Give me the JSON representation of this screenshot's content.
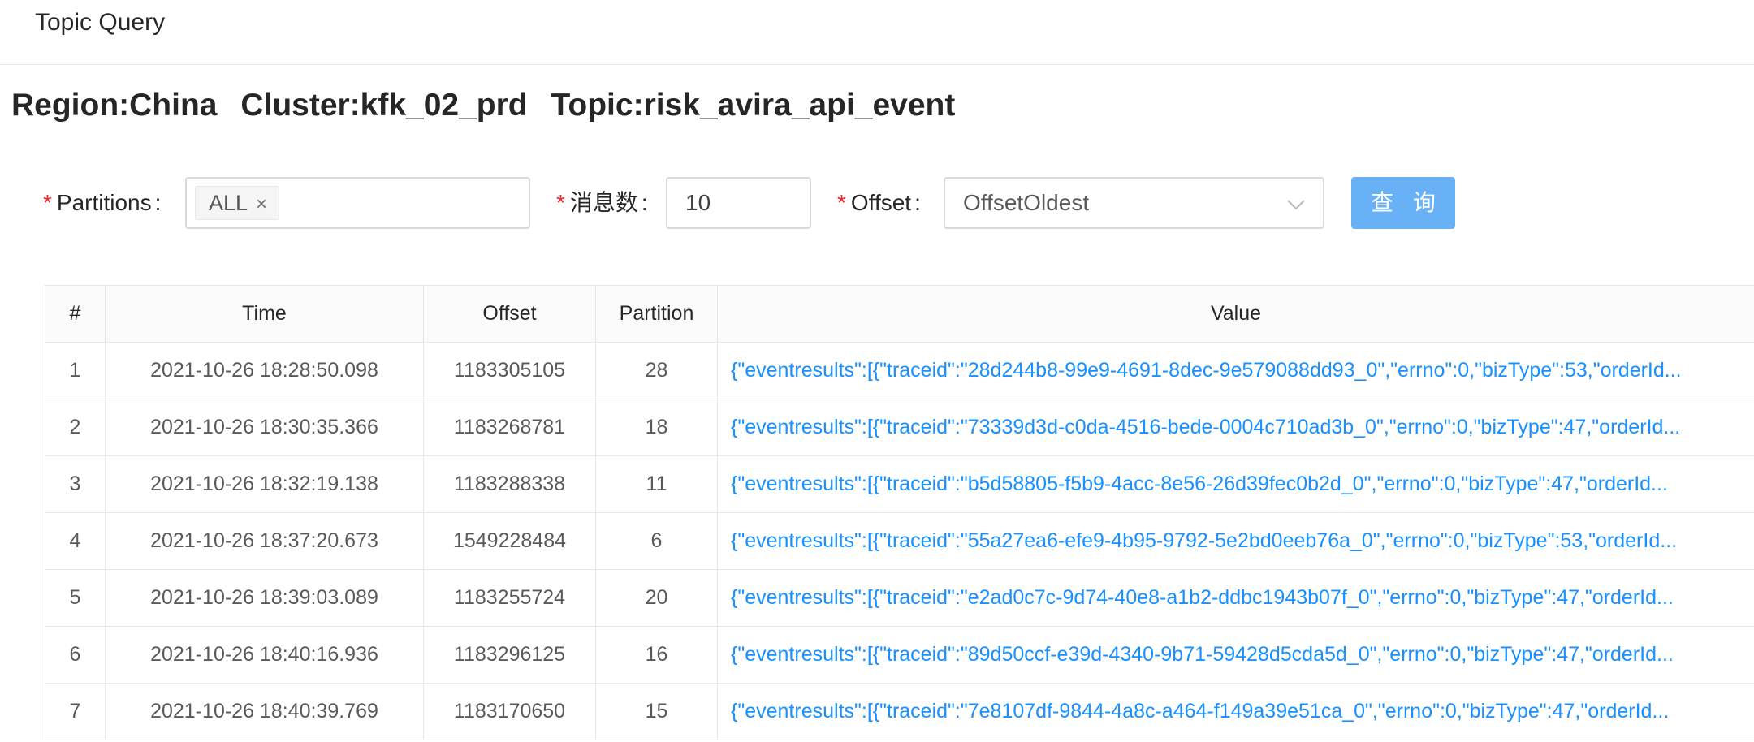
{
  "header": {
    "title": "Topic Query"
  },
  "heading": {
    "region": "Region:China",
    "cluster": "Cluster:kfk_02_prd",
    "topic": "Topic:risk_avira_api_event"
  },
  "form": {
    "partitions_label": "Partitions",
    "partitions_tag": "ALL",
    "count_label": "消息数",
    "count_value": "10",
    "offset_label": "Offset",
    "offset_value": "OffsetOldest",
    "query_button": "查 询",
    "colon": ":",
    "required_mark": "*"
  },
  "table": {
    "columns": [
      "#",
      "Time",
      "Offset",
      "Partition",
      "Value"
    ],
    "rows": [
      {
        "num": "1",
        "time": "2021-10-26 18:28:50.098",
        "offset": "1183305105",
        "partition": "28",
        "value": "{\"eventresults\":[{\"traceid\":\"28d244b8-99e9-4691-8dec-9e579088dd93_0\",\"errno\":0,\"bizType\":53,\"orderId..."
      },
      {
        "num": "2",
        "time": "2021-10-26 18:30:35.366",
        "offset": "1183268781",
        "partition": "18",
        "value": "{\"eventresults\":[{\"traceid\":\"73339d3d-c0da-4516-bede-0004c710ad3b_0\",\"errno\":0,\"bizType\":47,\"orderId..."
      },
      {
        "num": "3",
        "time": "2021-10-26 18:32:19.138",
        "offset": "1183288338",
        "partition": "11",
        "value": "{\"eventresults\":[{\"traceid\":\"b5d58805-f5b9-4acc-8e56-26d39fec0b2d_0\",\"errno\":0,\"bizType\":47,\"orderId..."
      },
      {
        "num": "4",
        "time": "2021-10-26 18:37:20.673",
        "offset": "1549228484",
        "partition": "6",
        "value": "{\"eventresults\":[{\"traceid\":\"55a27ea6-efe9-4b95-9792-5e2bd0eeb76a_0\",\"errno\":0,\"bizType\":53,\"orderId..."
      },
      {
        "num": "5",
        "time": "2021-10-26 18:39:03.089",
        "offset": "1183255724",
        "partition": "20",
        "value": "{\"eventresults\":[{\"traceid\":\"e2ad0c7c-9d74-40e8-a1b2-ddbc1943b07f_0\",\"errno\":0,\"bizType\":47,\"orderId..."
      },
      {
        "num": "6",
        "time": "2021-10-26 18:40:16.936",
        "offset": "1183296125",
        "partition": "16",
        "value": "{\"eventresults\":[{\"traceid\":\"89d50ccf-e39d-4340-9b71-59428d5cda5d_0\",\"errno\":0,\"bizType\":47,\"orderId..."
      },
      {
        "num": "7",
        "time": "2021-10-26 18:40:39.769",
        "offset": "1183170650",
        "partition": "15",
        "value": "{\"eventresults\":[{\"traceid\":\"7e8107df-9844-4a8c-a464-f149a39e51ca_0\",\"errno\":0,\"bizType\":47,\"orderId..."
      }
    ]
  },
  "colors": {
    "link": "#1890ff",
    "primary_button": "#69b1f6",
    "required": "#f5222d",
    "border": "#d9d9d9"
  },
  "icons": {
    "tag_close": "close-icon",
    "select_arrow": "chevron-down-icon"
  }
}
